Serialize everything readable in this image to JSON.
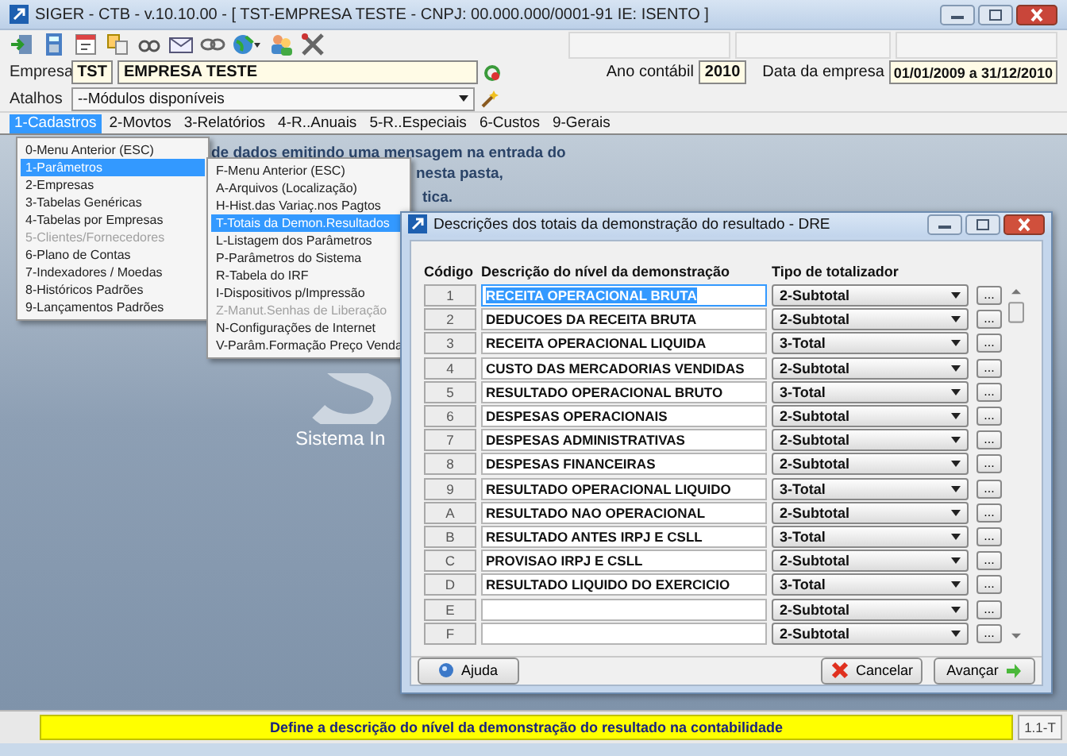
{
  "window": {
    "title": "SIGER - CTB - v.10.10.00 - [ TST-EMPRESA TESTE - CNPJ: 00.000.000/0001-91 IE: ISENTO ]"
  },
  "company": {
    "label": "Empresa",
    "code": "TST",
    "name": "EMPRESA TESTE",
    "year_label": "Ano contábil",
    "year": "2010",
    "date_label": "Data da empresa",
    "date_range": "01/01/2009 a 31/12/2010"
  },
  "shortcuts": {
    "label": "Atalhos",
    "value": "--Módulos disponíveis"
  },
  "menu_bar": [
    {
      "label": "1-Cadastros",
      "selected": true
    },
    {
      "label": "2-Movtos",
      "selected": false
    },
    {
      "label": "3-Relatórios",
      "selected": false
    },
    {
      "label": "4-R..Anuais",
      "selected": false
    },
    {
      "label": "5-R..Especiais",
      "selected": false
    },
    {
      "label": "6-Custos",
      "selected": false
    },
    {
      "label": "9-Gerais",
      "selected": false
    }
  ],
  "background": {
    "lines": [
      "de dados emitindo uma mensagem na entrada do",
      "nesta pasta,",
      "tica."
    ],
    "logo_caption": "Sistema In"
  },
  "menu": [
    {
      "label": "0-Menu Anterior (ESC)",
      "selected": false,
      "disabled": false
    },
    {
      "label": "1-Parâmetros",
      "selected": true,
      "disabled": false
    },
    {
      "label": "2-Empresas",
      "selected": false,
      "disabled": false
    },
    {
      "label": "3-Tabelas Genéricas",
      "selected": false,
      "disabled": false
    },
    {
      "label": "4-Tabelas por Empresas",
      "selected": false,
      "disabled": false
    },
    {
      "label": "5-Clientes/Fornecedores",
      "selected": false,
      "disabled": true
    },
    {
      "label": "6-Plano de Contas",
      "selected": false,
      "disabled": false
    },
    {
      "label": "7-Indexadores / Moedas",
      "selected": false,
      "disabled": false
    },
    {
      "label": "8-Históricos Padrões",
      "selected": false,
      "disabled": false
    },
    {
      "label": "9-Lançamentos Padrões",
      "selected": false,
      "disabled": false
    }
  ],
  "submenu": [
    {
      "label": "F-Menu Anterior (ESC)",
      "selected": false,
      "disabled": false
    },
    {
      "label": "A-Arquivos (Localização)",
      "selected": false,
      "disabled": false
    },
    {
      "label": "H-Hist.das Variaç.nos Pagtos",
      "selected": false,
      "disabled": false
    },
    {
      "label": "T-Totais da Demon.Resultados",
      "selected": true,
      "disabled": false
    },
    {
      "label": "L-Listagem dos Parâmetros",
      "selected": false,
      "disabled": false
    },
    {
      "label": "P-Parâmetros do Sistema",
      "selected": false,
      "disabled": false
    },
    {
      "label": "R-Tabela do IRF",
      "selected": false,
      "disabled": false
    },
    {
      "label": "I-Dispositivos p/Impressão",
      "selected": false,
      "disabled": false
    },
    {
      "label": "Z-Manut.Senhas de Liberação",
      "selected": false,
      "disabled": true
    },
    {
      "label": "N-Configurações de Internet",
      "selected": false,
      "disabled": false
    },
    {
      "label": "V-Parâm.Formação Preço Venda",
      "selected": false,
      "disabled": false
    }
  ],
  "dialog": {
    "title": "Descrições dos totais da demonstração do resultado - DRE",
    "columns": [
      "Código",
      "Descrição do nível da demonstração",
      "Tipo de totalizador"
    ],
    "rows": [
      {
        "code": "1",
        "description": "RECEITA OPERACIONAL BRUTA",
        "type": "2-Subtotal",
        "button": "...",
        "selected": true
      },
      {
        "code": "2",
        "description": "DEDUCOES DA RECEITA BRUTA",
        "type": "2-Subtotal",
        "button": "...",
        "selected": false
      },
      {
        "code": "3",
        "description": "RECEITA OPERACIONAL LIQUIDA",
        "type": "3-Total",
        "button": "...",
        "selected": false
      },
      {
        "code": "4",
        "description": "CUSTO DAS MERCADORIAS VENDIDAS",
        "type": "2-Subtotal",
        "button": "...",
        "selected": false
      },
      {
        "code": "5",
        "description": "RESULTADO OPERACIONAL BRUTO",
        "type": "3-Total",
        "button": "...",
        "selected": false
      },
      {
        "code": "6",
        "description": "DESPESAS OPERACIONAIS",
        "type": "2-Subtotal",
        "button": "...",
        "selected": false
      },
      {
        "code": "7",
        "description": "DESPESAS ADMINISTRATIVAS",
        "type": "2-Subtotal",
        "button": "...",
        "selected": false
      },
      {
        "code": "8",
        "description": "DESPESAS FINANCEIRAS",
        "type": "2-Subtotal",
        "button": "...",
        "selected": false
      },
      {
        "code": "9",
        "description": "RESULTADO OPERACIONAL LIQUIDO",
        "type": "3-Total",
        "button": "...",
        "selected": false
      },
      {
        "code": "A",
        "description": "RESULTADO NAO OPERACIONAL",
        "type": "2-Subtotal",
        "button": "...",
        "selected": false
      },
      {
        "code": "B",
        "description": "RESULTADO ANTES IRPJ E CSLL",
        "type": "3-Total",
        "button": "...",
        "selected": false
      },
      {
        "code": "C",
        "description": "PROVISAO IRPJ E CSLL",
        "type": "2-Subtotal",
        "button": "...",
        "selected": false
      },
      {
        "code": "D",
        "description": "RESULTADO LIQUIDO DO EXERCICIO",
        "type": "3-Total",
        "button": "...",
        "selected": false
      },
      {
        "code": "E",
        "type": "2-Subtotal",
        "button": "...",
        "selected": false
      },
      {
        "code": "F",
        "type": "2-Subtotal",
        "button": "...",
        "selected": false
      }
    ],
    "buttons": [
      {
        "label": "Ajuda",
        "kind": "help"
      },
      {
        "label": "Cancelar",
        "kind": "cancel"
      },
      {
        "label": "Avançar",
        "kind": "next"
      }
    ]
  },
  "status_bar": {
    "message": "Define a descrição do nível da demonstração do resultado na contabilidade",
    "code": "1.1-T"
  }
}
